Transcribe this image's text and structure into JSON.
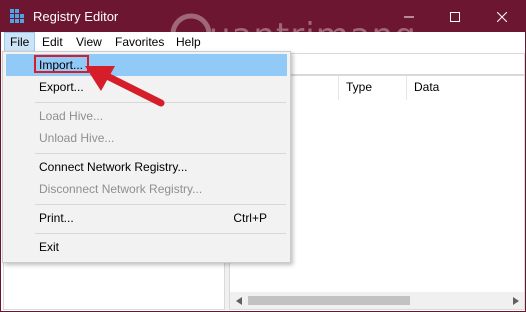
{
  "window": {
    "title": "Registry Editor"
  },
  "menubar": {
    "file": "File",
    "edit": "Edit",
    "view": "View",
    "favorites": "Favorites",
    "help": "Help"
  },
  "list": {
    "columns": [
      "Type",
      "Data"
    ]
  },
  "file_menu": {
    "items": [
      {
        "label": "Import...",
        "shortcut": "",
        "enabled": true
      },
      {
        "label": "Export...",
        "shortcut": "",
        "enabled": true
      },
      {
        "label": "Load Hive...",
        "shortcut": "",
        "enabled": false
      },
      {
        "label": "Unload Hive...",
        "shortcut": "",
        "enabled": false
      },
      {
        "label": "Connect Network Registry...",
        "shortcut": "",
        "enabled": true
      },
      {
        "label": "Disconnect Network Registry...",
        "shortcut": "",
        "enabled": false
      },
      {
        "label": "Print...",
        "shortcut": "Ctrl+P",
        "enabled": true
      },
      {
        "label": "Exit",
        "shortcut": "",
        "enabled": true
      }
    ]
  },
  "watermark": {
    "text": "uantrimang"
  },
  "colors": {
    "titlebar": "#6d1632",
    "highlight": "#91c9f7",
    "annotation": "#d61e2a"
  }
}
